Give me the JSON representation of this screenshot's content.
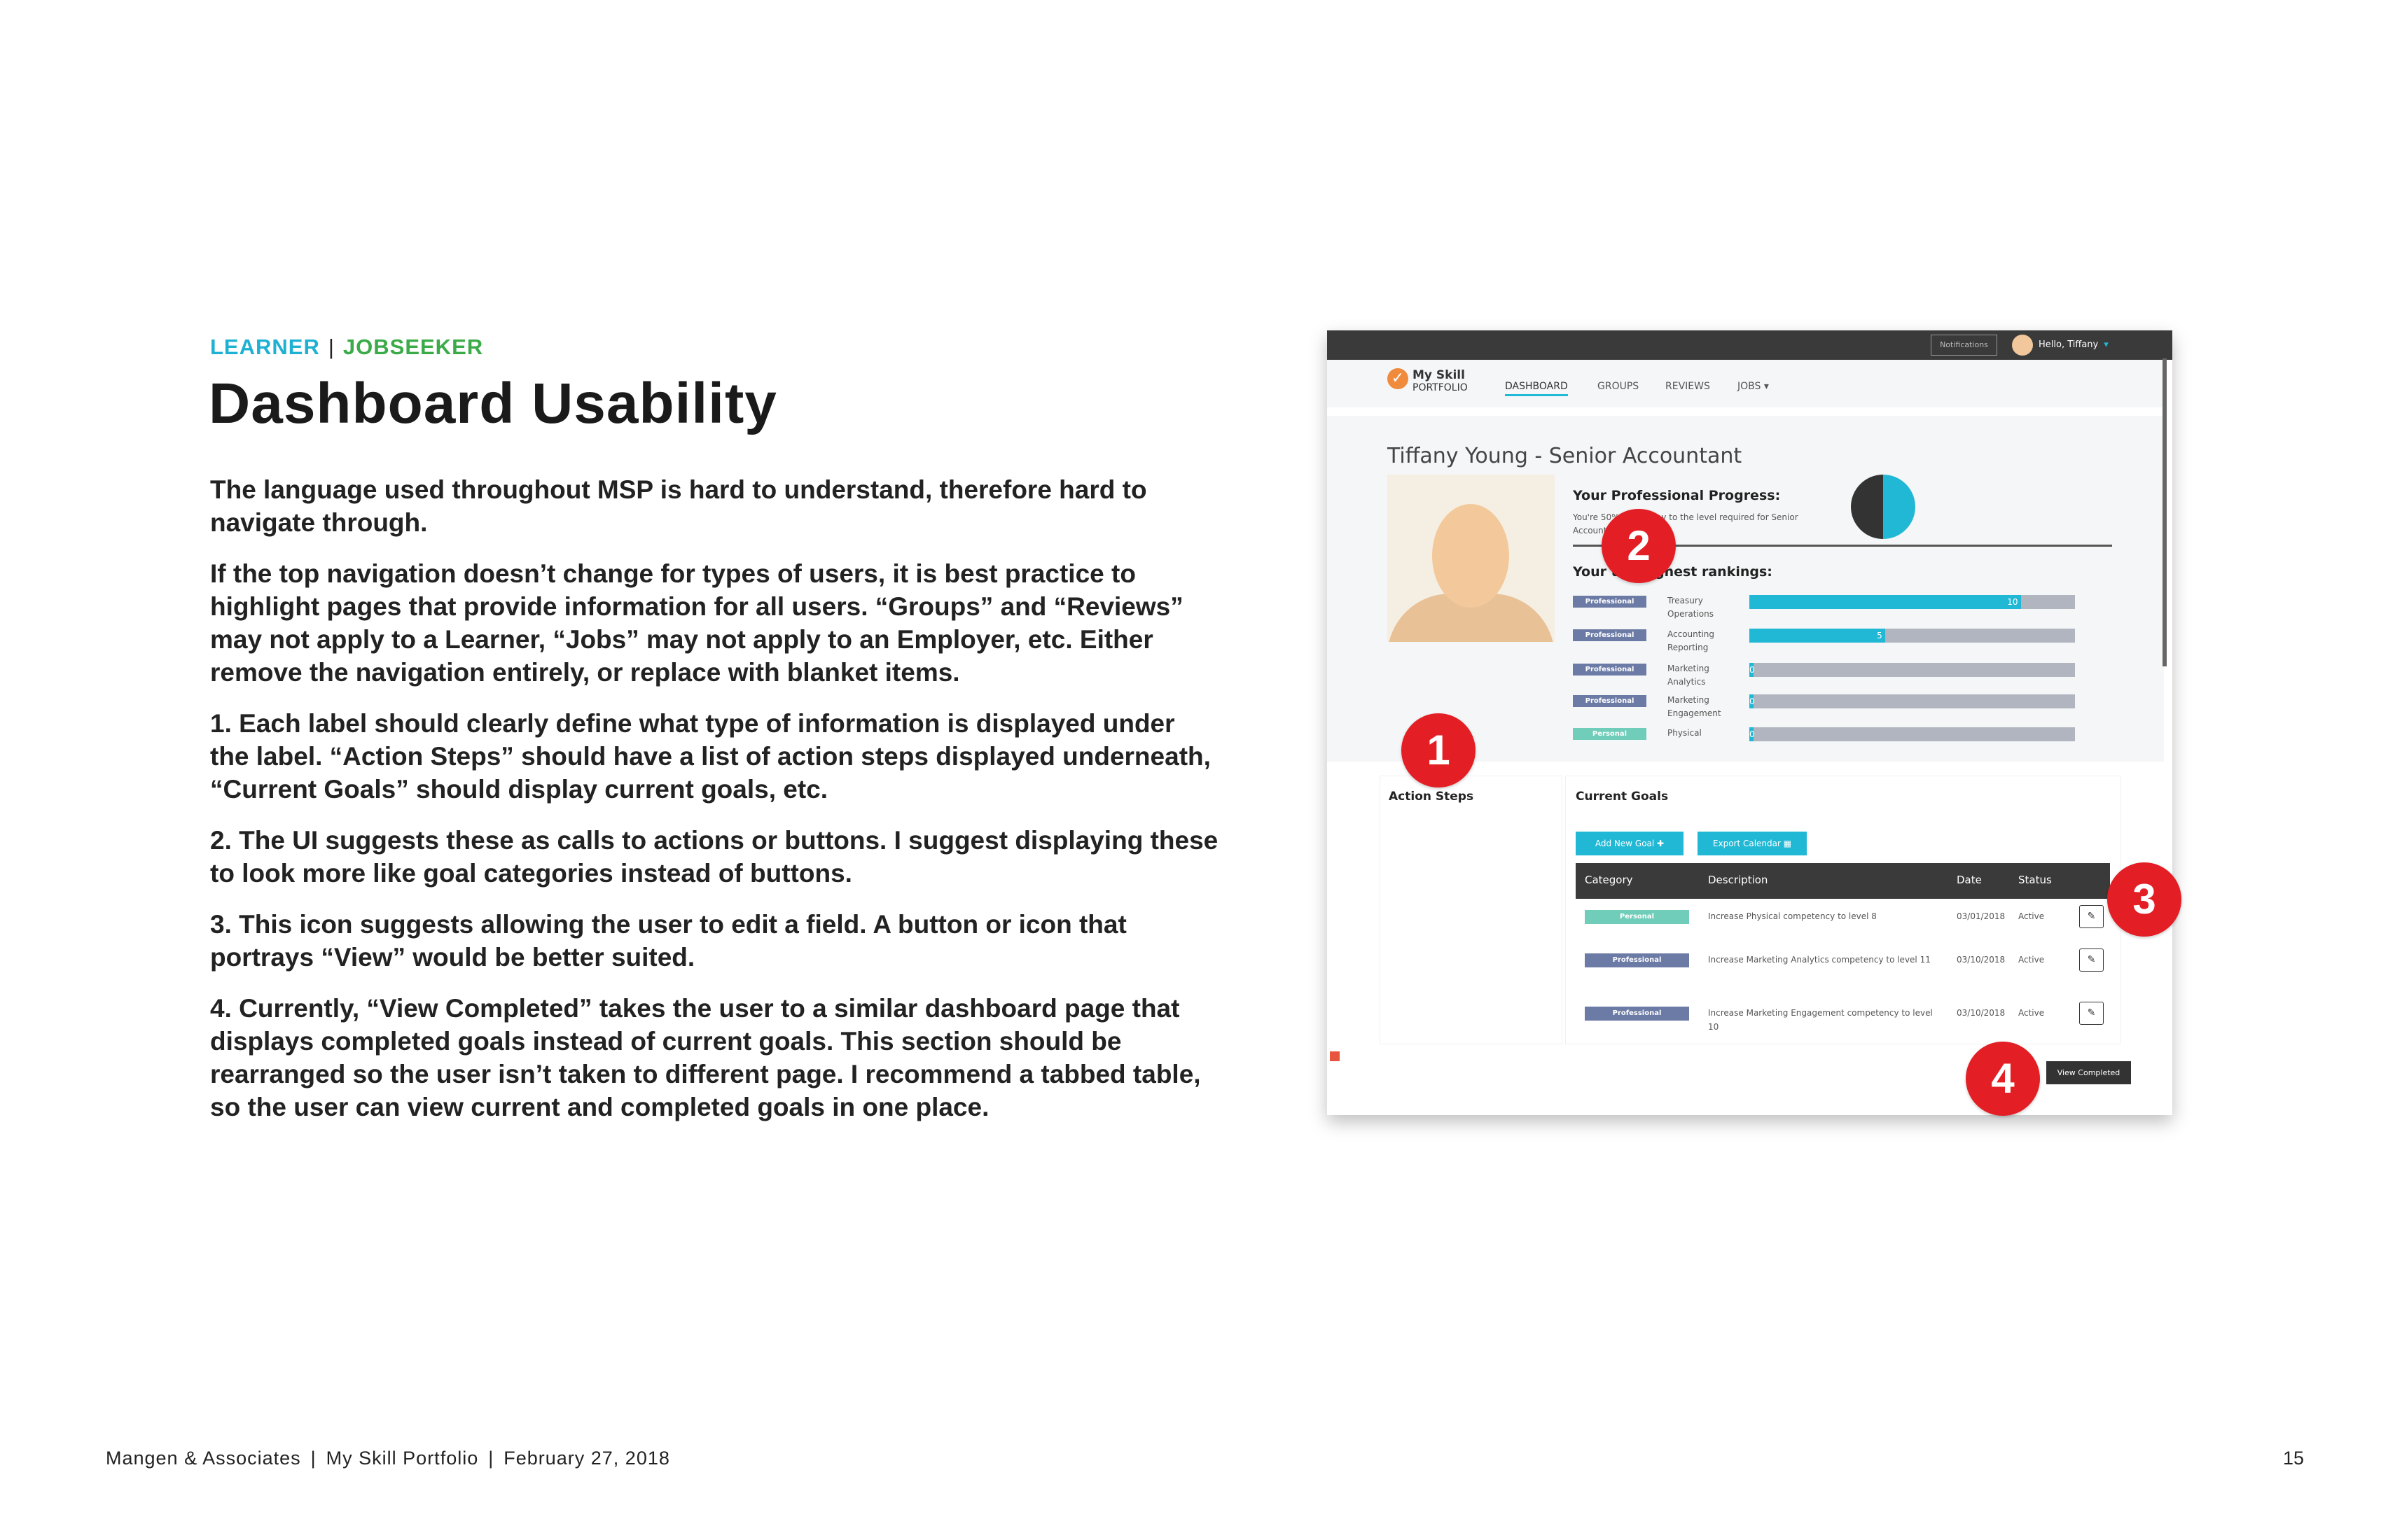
{
  "slide": {
    "tag_learner": "LEARNER",
    "tag_separator": "|",
    "tag_jobseeker": "JOBSEEKER",
    "title": "Dashboard Usability",
    "paragraphs": [
      "The language used throughout MSP is hard to understand, therefore hard to navigate through.",
      "If the top navigation doesn’t change for types of users, it is best practice to highlight pages that provide information for all users. “Groups” and “Reviews” may not apply to a Learner, “Jobs” may  not apply to an Employer, etc. Either remove the navigation entirely, or replace with blanket items.",
      "1. Each label should clearly define what type of information is displayed under the label. “Action Steps” should have a list of action steps displayed underneath, “Current Goals” should display current goals, etc.",
      "2. The UI suggests these as calls to actions or buttons. I suggest displaying these to look more like goal categories instead of buttons.",
      "3. This icon suggests allowing the user to edit a field. A button or icon that portrays “View” would be better suited.",
      "4. Currently, “View Completed” takes the user to a similar dashboard page that displays completed goals instead of current goals. This section should be rearranged so the user isn’t taken to different page. I recommend a tabbed table, so the user can view current and completed goals in one place."
    ],
    "colors": {
      "learner": "#1fb1d3",
      "jobseeker": "#3aab48",
      "marker": "#e31e24"
    },
    "footer": {
      "company": "Mangen & Associates",
      "project": "My Skill Portfolio",
      "date": "February 27, 2018",
      "separator": "|"
    },
    "page_number": "15",
    "markers": [
      "1",
      "2",
      "3",
      "4"
    ]
  },
  "mockup": {
    "topbar": {
      "notifications": "Notifications",
      "greeting": "Hello, Tiffany",
      "caret": "▾"
    },
    "logo": {
      "line1": "My Skill",
      "line2": "PORTFOLIO",
      "icon": "checkmark-icon"
    },
    "nav": [
      "DASHBOARD",
      "GROUPS",
      "REVIEWS",
      "JOBS ▾"
    ],
    "nav_active": "DASHBOARD",
    "profile_title": "Tiffany Young - Senior Accountant",
    "progress_heading": "Your Professional Progress:",
    "progress_text_1": "You're 50% of the way to the level required for Senior",
    "progress_text_2": "Accountant",
    "progress_fraction": 0.5,
    "rankings_heading": "Your top highest rankings:",
    "rankings_max": 12,
    "rankings": [
      {
        "category": "Professional",
        "skill": "Treasury Operations",
        "value": 10
      },
      {
        "category": "Professional",
        "skill": "Accounting Reporting",
        "value": 5
      },
      {
        "category": "Professional",
        "skill": "Marketing Analytics",
        "value": 0
      },
      {
        "category": "Professional",
        "skill": "Marketing Engagement",
        "value": 0
      },
      {
        "category": "Personal",
        "skill": "Physical",
        "value": 0
      }
    ],
    "action_steps_label": "Action Steps",
    "current_goals_label": "Current Goals",
    "add_goal_button": "Add New Goal ✚",
    "export_button": "Export Calendar ▦",
    "table_headers": [
      "Category",
      "Description",
      "Date",
      "Status"
    ],
    "goals": [
      {
        "category": "Personal",
        "description": "Increase Physical competency to level 8",
        "date": "03/01/2018",
        "status": "Active"
      },
      {
        "category": "Professional",
        "description": "Increase Marketing Analytics competency to level 11",
        "date": "03/10/2018",
        "status": "Active"
      },
      {
        "category": "Professional",
        "description": "Increase Marketing Engagement competency to level 10",
        "date": "03/10/2018",
        "status": "Active"
      }
    ],
    "edit_icon": "✎",
    "view_completed": "View Completed"
  }
}
